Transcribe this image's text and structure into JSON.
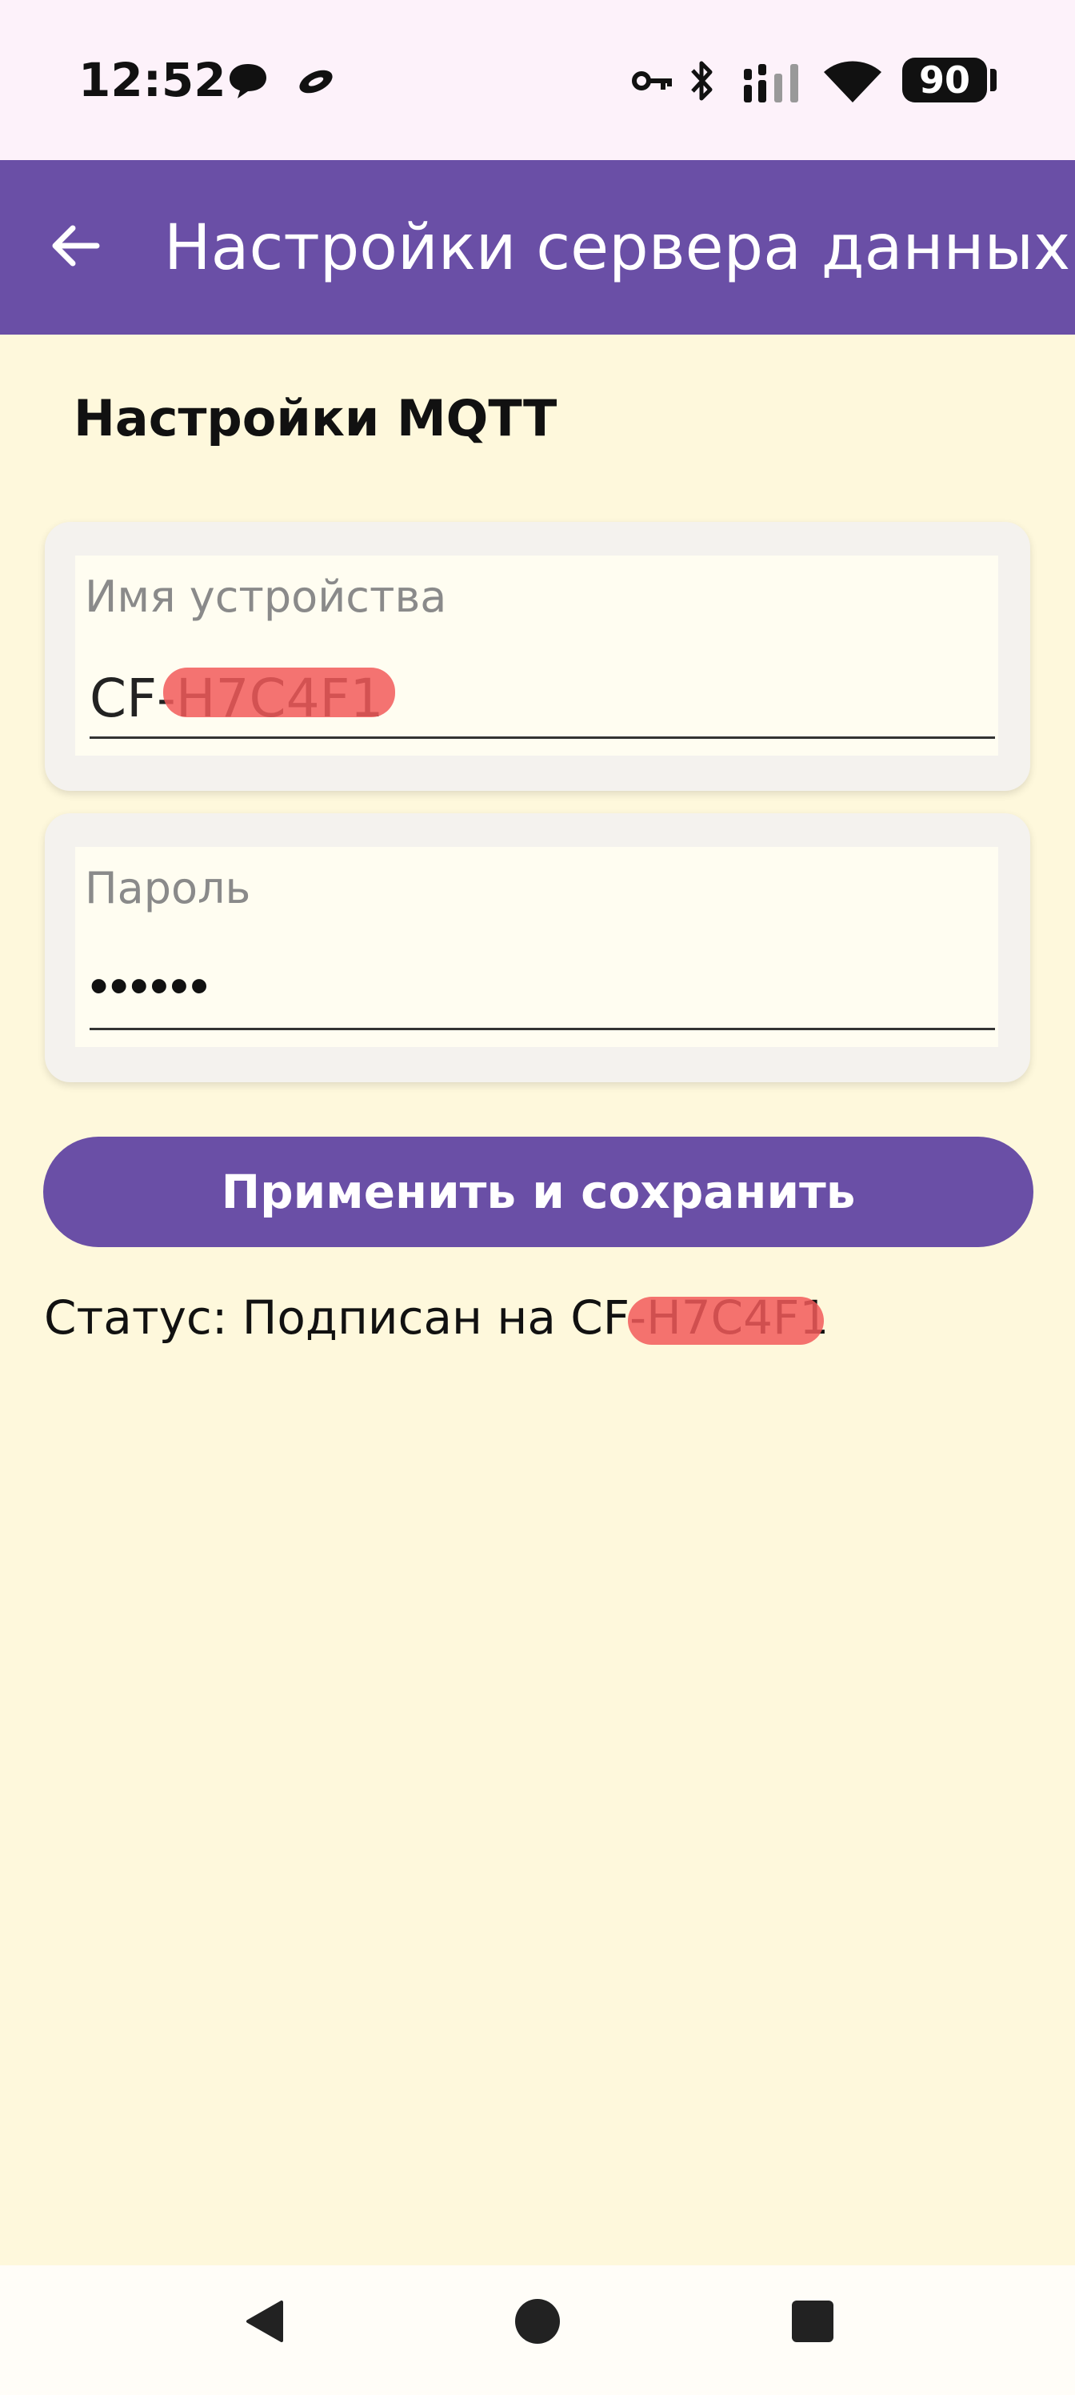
{
  "status_bar": {
    "time": "12:52",
    "battery": "90",
    "icons": [
      "chat-bubble-icon",
      "notification-icon",
      "vpn-key-icon",
      "bluetooth-icon",
      "signal-icon",
      "wifi-icon",
      "battery-icon"
    ]
  },
  "app_bar": {
    "title": "Настройки сервера данных",
    "back_icon": "arrow-back-icon",
    "color": "#6a4fa6"
  },
  "section": {
    "title": "Настройки MQTT"
  },
  "device_field": {
    "label": "Имя устройства",
    "value": "CF-H7C4F1"
  },
  "password_field": {
    "label": "Пароль",
    "value": "••••••"
  },
  "apply_button": {
    "label": "Применить и сохранить"
  },
  "status": {
    "text": "Статус: Подписан на CF-H7C4F1"
  },
  "nav_bar": {
    "back_icon": "nav-back-icon",
    "home_icon": "nav-home-icon",
    "recents_icon": "nav-recents-icon"
  }
}
